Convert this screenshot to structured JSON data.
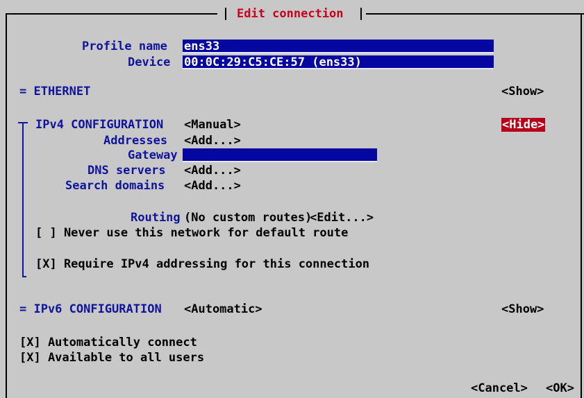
{
  "dialog": {
    "title": "Edit connection"
  },
  "profile": {
    "name_label": "Profile name",
    "name_value": "ens33",
    "device_label": "Device",
    "device_value": "00:0C:29:C5:CE:57 (ens33)"
  },
  "ethernet": {
    "label": "= ETHERNET",
    "toggle": "<Show>"
  },
  "ipv4": {
    "label": "IPv4 CONFIGURATION",
    "method": "<Manual>",
    "toggle": "<Hide>",
    "addresses_label": "Addresses",
    "addresses_action": "<Add...>",
    "gateway_label": "Gateway",
    "gateway_value": "",
    "dns_label": "DNS servers",
    "dns_action": "<Add...>",
    "search_label": "Search domains",
    "search_action": "<Add...>",
    "routing_label": "Routing",
    "routing_value": "(No custom routes)",
    "routing_action": "<Edit...>",
    "never_default": "[ ] Never use this network for default route",
    "require_ipv4": "[X] Require IPv4 addressing for this connection"
  },
  "ipv6": {
    "label": "= IPv6 CONFIGURATION",
    "method": "<Automatic>",
    "toggle": "<Show>"
  },
  "options": {
    "auto_connect": "[X] Automatically connect",
    "all_users": "[X] Available to all users"
  },
  "buttons": {
    "cancel": "<Cancel>",
    "ok": "<OK>"
  },
  "colors": {
    "background": "#c8c8c8",
    "label_blue": "#0f149a",
    "field_blue": "#0606a0",
    "title_red": "#c8001c",
    "selected_red": "#b80018"
  }
}
